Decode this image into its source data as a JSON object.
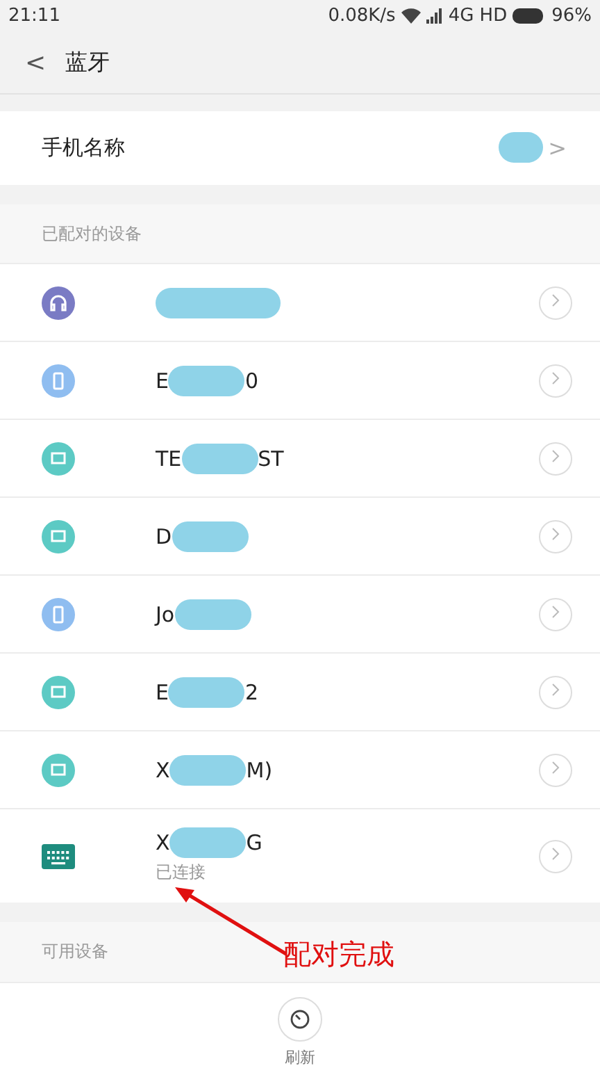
{
  "status_bar": {
    "time": "21:11",
    "speed": "0.08K/s",
    "network": "4G HD",
    "battery": "96%"
  },
  "header": {
    "back": "<",
    "title": "蓝牙"
  },
  "phone_name": {
    "label": "手机名称",
    "chevron": ">"
  },
  "paired_section": {
    "label": "已配对的设备"
  },
  "devices": [
    {
      "kind": "headset",
      "color": "#7a7bc4"
    },
    {
      "kind": "phone",
      "color": "#8fbdf0",
      "name_start": "E",
      "name_end": "0"
    },
    {
      "kind": "laptop",
      "color": "#5ccac4",
      "name_start": "TE",
      "name_end": "ST"
    },
    {
      "kind": "laptop",
      "color": "#5ccac4",
      "name_start": "D"
    },
    {
      "kind": "phone",
      "color": "#8fbdf0",
      "name_start": "Jo"
    },
    {
      "kind": "laptop",
      "color": "#5ccac4",
      "name_start": "E",
      "name_end": "2"
    },
    {
      "kind": "laptop",
      "color": "#5ccac4",
      "name_start": "X",
      "name_end": "M)"
    },
    {
      "kind": "keyboard",
      "color": "#1e8c7e",
      "name_start": "X",
      "name_end": "G",
      "status": "已连接"
    }
  ],
  "available_section": {
    "label": "可用设备"
  },
  "refresh": {
    "label": "刷新"
  },
  "annotation": {
    "text": "配对完成"
  }
}
